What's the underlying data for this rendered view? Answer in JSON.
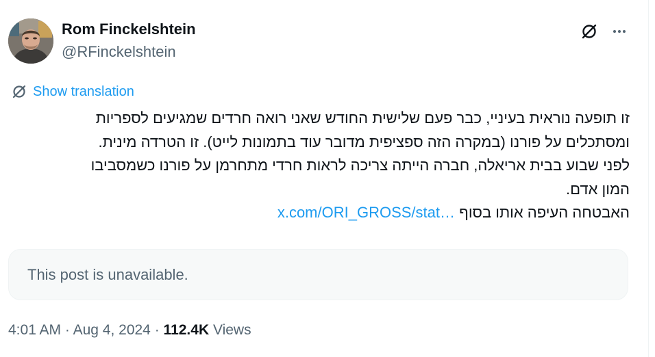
{
  "author": {
    "name": "Rom Finckelshtein",
    "handle": "@RFinckelshtein",
    "avatar_icon": "person-photo-avatar"
  },
  "header_actions": {
    "grok_icon": "grok-icon",
    "more_icon": "more-horizontal-icon",
    "more_glyph": "···"
  },
  "translation": {
    "icon": "grok-icon",
    "label": "Show translation"
  },
  "post": {
    "lines": [
      "זו תופעה נוראית בעיניי, כבר פעם שלישית החודש שאני רואה חרדים שמגיעים לספריות",
      "ומסתכלים על פורנו (במקרה הזה ספציפית מדובר עוד בתמונות לייט). זו הטרדה מינית.",
      "לפני שבוע בבית אריאלה, חברה הייתה צריכה לראות חרדי מתחרמן על פורנו כשמסביבו",
      "המון אדם."
    ],
    "last_line_text": "האבטחה העיפה אותו בסוף",
    "link_text": "x.com/ORI_GROSS/stat…"
  },
  "quote": {
    "text": "This post is unavailable."
  },
  "meta": {
    "time": "4:01 AM",
    "separator": "·",
    "date": "Aug 4, 2024",
    "views_count": "112.4K",
    "views_label": "Views"
  },
  "colors": {
    "link": "#1d9bf0",
    "secondary_text": "#536471",
    "primary_text": "#0f1419",
    "quote_background": "#f7f9f9"
  }
}
